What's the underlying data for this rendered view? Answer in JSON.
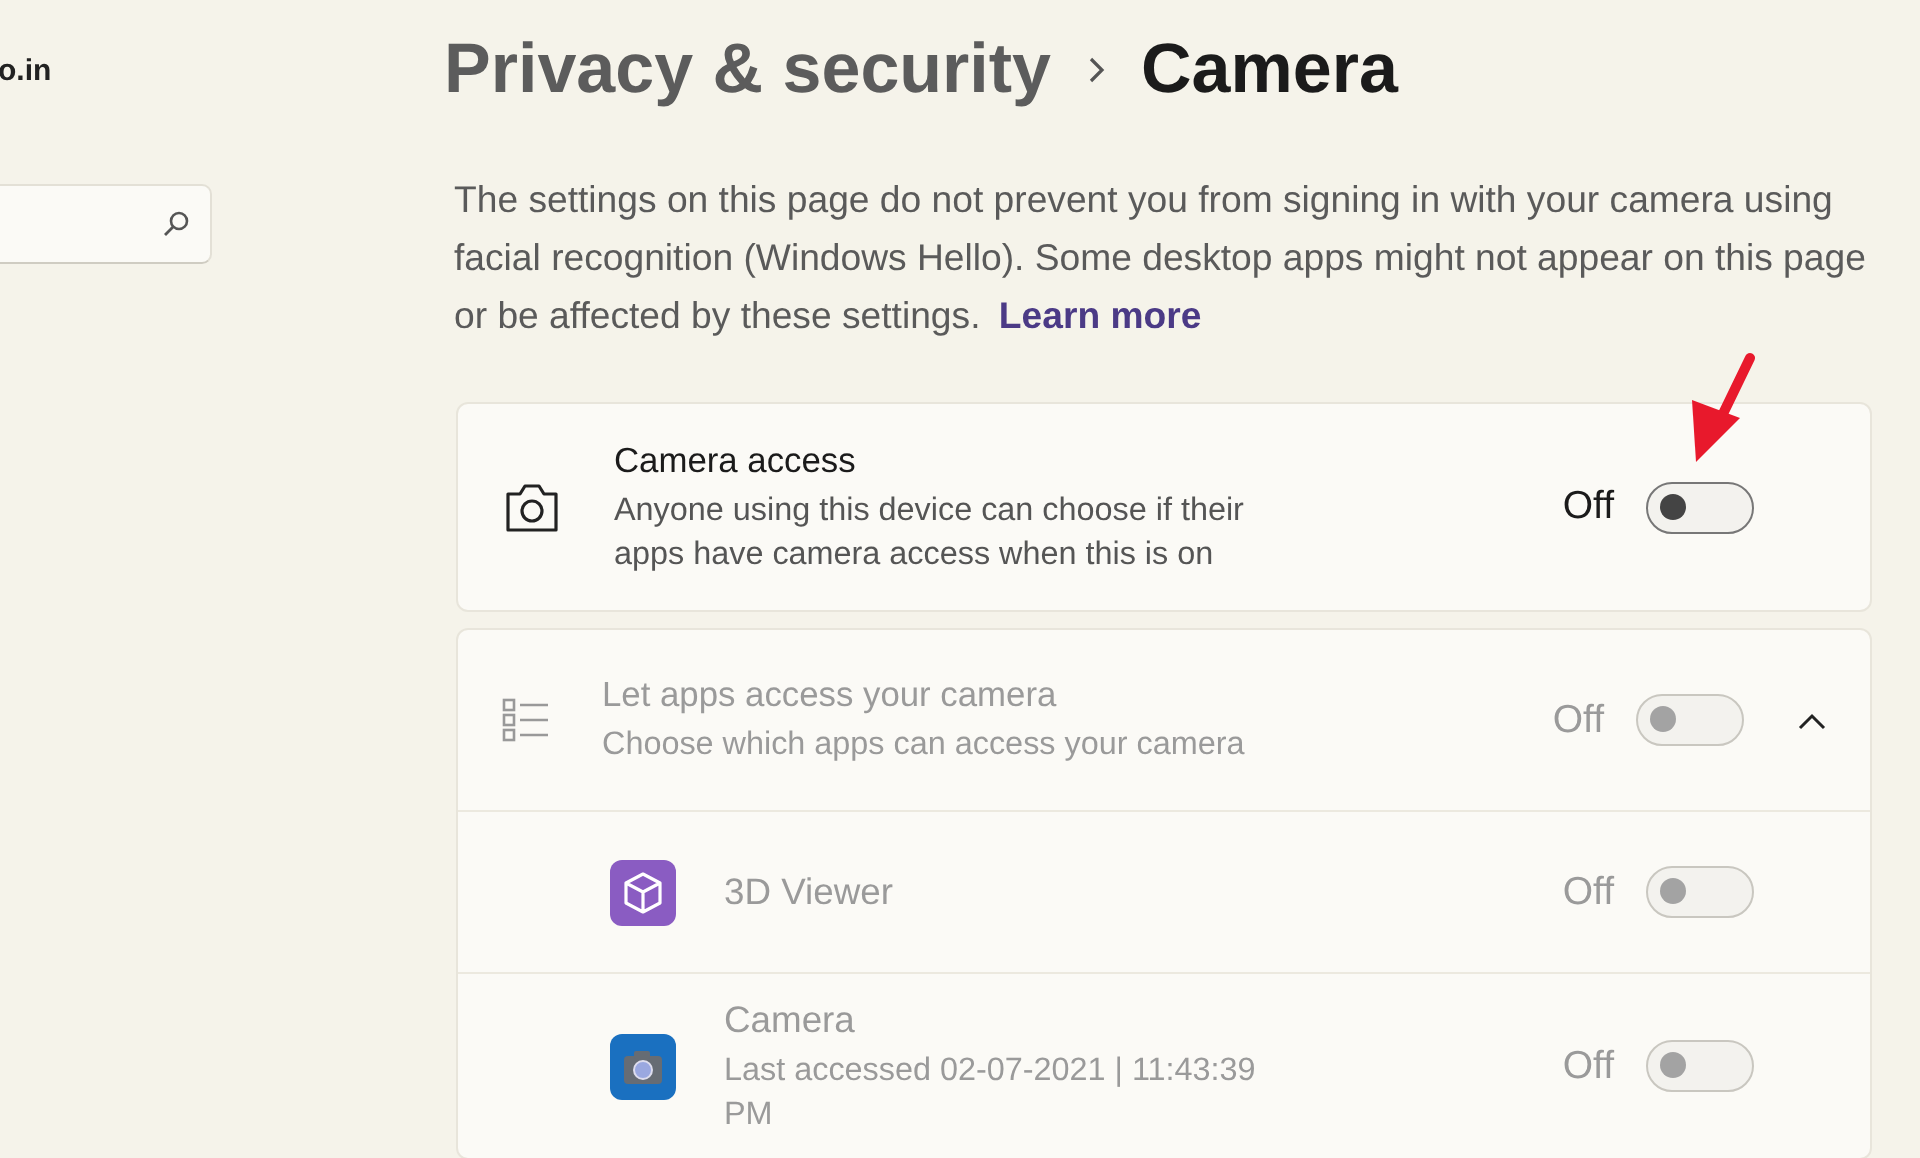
{
  "sidebar": {
    "account_text": "o.in"
  },
  "breadcrumb": [
    {
      "label": "Privacy & security",
      "current": false
    },
    {
      "label": "Camera",
      "current": true
    }
  ],
  "description": {
    "text": "The settings on this page do not prevent you from signing in with your camera using facial recognition (Windows Hello). Some desktop apps might not appear on this page or be affected by these settings.",
    "link": "Learn more"
  },
  "camera_access": {
    "title": "Camera access",
    "subtitle": "Anyone using this device can choose if their apps have camera access when this is on",
    "state_label": "Off",
    "on": false,
    "disabled": false
  },
  "app_access": {
    "title": "Let apps access your camera",
    "subtitle": "Choose which apps can access your camera",
    "state_label": "Off",
    "on": false,
    "disabled": true,
    "expanded": true,
    "apps": [
      {
        "kind": "viewer",
        "name": "3D Viewer",
        "state_label": "Off",
        "on": false,
        "disabled": true
      },
      {
        "kind": "camera",
        "name": "Camera",
        "detail": "Last accessed 02-07-2021 | 11:43:39 PM",
        "state_label": "Off",
        "on": false,
        "disabled": true
      }
    ]
  }
}
